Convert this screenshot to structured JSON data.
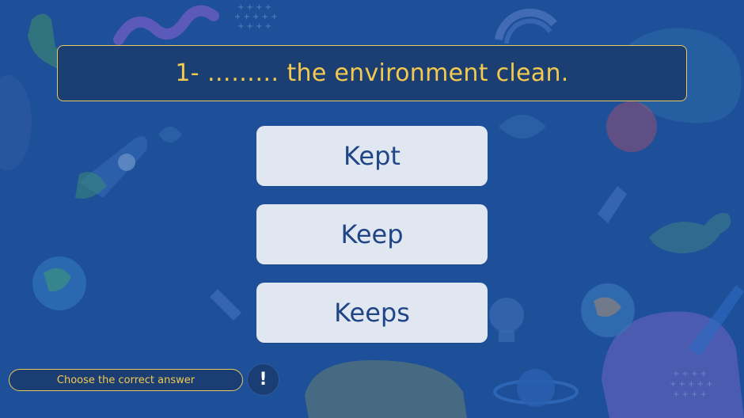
{
  "question": {
    "text": "1- ……… the environment clean."
  },
  "options": [
    {
      "label": "Kept"
    },
    {
      "label": "Keep"
    },
    {
      "label": "Keeps"
    }
  ],
  "footer": {
    "instruction": "Choose the correct answer",
    "hint_symbol": "!",
    "hint_icon": "exclamation-icon"
  },
  "colors": {
    "background": "#1e4f99",
    "question_text": "#f3c94f",
    "border_accent": "#e8c95a",
    "option_bg": "#e1e7f1",
    "option_text": "#1f4587"
  }
}
